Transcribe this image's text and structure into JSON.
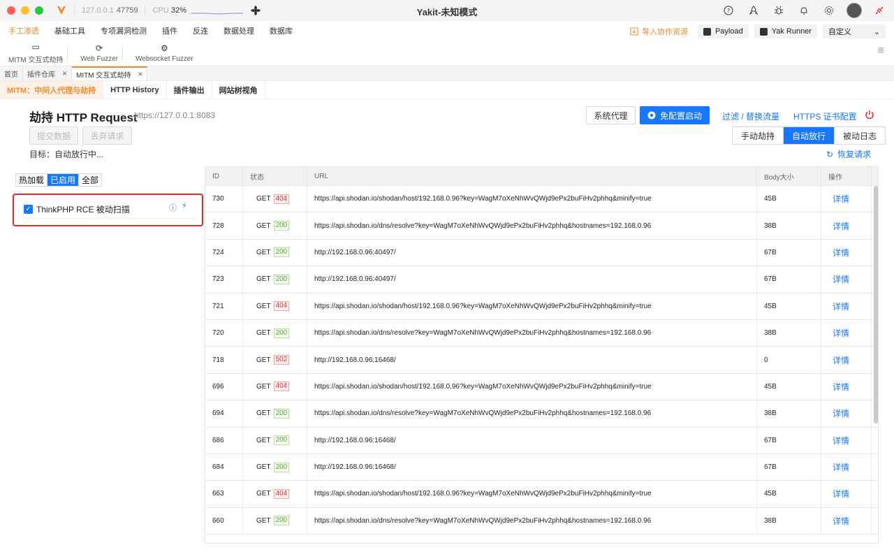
{
  "window": {
    "ip": "127.0.0.1",
    "port": "47759",
    "cpu_label": "CPU",
    "cpu_value": "32%",
    "title": "Yakit-未知模式"
  },
  "menu": {
    "items": [
      "手工渗透",
      "基础工具",
      "专项漏洞检测",
      "插件",
      "反连",
      "数据处理",
      "数据库"
    ],
    "import_label": "导入协作资源",
    "payload_label": "Payload",
    "yakrunner_label": "Yak Runner",
    "custom_label": "自定义"
  },
  "toolbar": {
    "items": [
      "MITM 交互式劫持",
      "Web Fuzzer",
      "Websocket Fuzzer"
    ]
  },
  "page_tabs": [
    "首页",
    "插件仓库",
    "MITM 交互式劫持"
  ],
  "sub_tabs": [
    "MITM：中间人代理与劫持",
    "HTTP History",
    "插件输出",
    "网站树视角"
  ],
  "header": {
    "title": "劫持 HTTP Request",
    "url": "https://127.0.0.1:8083",
    "submit_label": "提交数据",
    "discard_label": "丢弃请求",
    "target_text": "目标：自动放行中...",
    "system_proxy_label": "系统代理",
    "noconfig_label": "免配置启动",
    "filter_label": "过滤 / 替换流量",
    "https_label": "HTTPS 证书配置",
    "modes": [
      "手动劫持",
      "自动放行",
      "被动日志"
    ],
    "restore_label": "恢复请求"
  },
  "plugins": {
    "filters": [
      "热加载",
      "已启用",
      "全部"
    ],
    "item_name": "ThinkPHP RCE 被动扫描"
  },
  "table": {
    "columns": [
      "ID",
      "状态",
      "URL",
      "Body大小",
      "操作"
    ],
    "action_label": "详情",
    "rows": [
      {
        "id": "730",
        "method": "GET",
        "code": "404",
        "url": "https://api.shodan.io/shodan/host/192.168.0.96?key=WagM7oXeNhWvQWjd9ePx2buFiHv2phhq&minify=true",
        "size": "45B"
      },
      {
        "id": "728",
        "method": "GET",
        "code": "200",
        "url": "https://api.shodan.io/dns/resolve?key=WagM7oXeNhWvQWjd9ePx2buFiHv2phhq&hostnames=192.168.0.96",
        "size": "38B"
      },
      {
        "id": "724",
        "method": "GET",
        "code": "200",
        "url": "http://192.168.0.96:40497/",
        "size": "67B"
      },
      {
        "id": "723",
        "method": "GET",
        "code": "200",
        "url": "http://192.168.0.96:40497/",
        "size": "67B"
      },
      {
        "id": "721",
        "method": "GET",
        "code": "404",
        "url": "https://api.shodan.io/shodan/host/192.168.0.96?key=WagM7oXeNhWvQWjd9ePx2buFiHv2phhq&minify=true",
        "size": "45B"
      },
      {
        "id": "720",
        "method": "GET",
        "code": "200",
        "url": "https://api.shodan.io/dns/resolve?key=WagM7oXeNhWvQWjd9ePx2buFiHv2phhq&hostnames=192.168.0.96",
        "size": "38B"
      },
      {
        "id": "718",
        "method": "GET",
        "code": "502",
        "url": "http://192.168.0.96:16468/",
        "size": "0"
      },
      {
        "id": "696",
        "method": "GET",
        "code": "404",
        "url": "https://api.shodan.io/shodan/host/192.168.0.96?key=WagM7oXeNhWvQWjd9ePx2buFiHv2phhq&minify=true",
        "size": "45B"
      },
      {
        "id": "694",
        "method": "GET",
        "code": "200",
        "url": "https://api.shodan.io/dns/resolve?key=WagM7oXeNhWvQWjd9ePx2buFiHv2phhq&hostnames=192.168.0.96",
        "size": "38B"
      },
      {
        "id": "686",
        "method": "GET",
        "code": "200",
        "url": "http://192.168.0.96:16468/",
        "size": "67B"
      },
      {
        "id": "684",
        "method": "GET",
        "code": "200",
        "url": "http://192.168.0.96:16468/",
        "size": "67B"
      },
      {
        "id": "663",
        "method": "GET",
        "code": "404",
        "url": "https://api.shodan.io/shodan/host/192.168.0.96?key=WagM7oXeNhWvQWjd9ePx2buFiHv2phhq&minify=true",
        "size": "45B"
      },
      {
        "id": "660",
        "method": "GET",
        "code": "200",
        "url": "https://api.shodan.io/dns/resolve?key=WagM7oXeNhWvQWjd9ePx2buFiHv2phhq&hostnames=192.168.0.96",
        "size": "38B"
      }
    ]
  },
  "colors": {
    "accent": "#f28b2d",
    "primary": "#1677ff",
    "error": "#e8242a"
  }
}
